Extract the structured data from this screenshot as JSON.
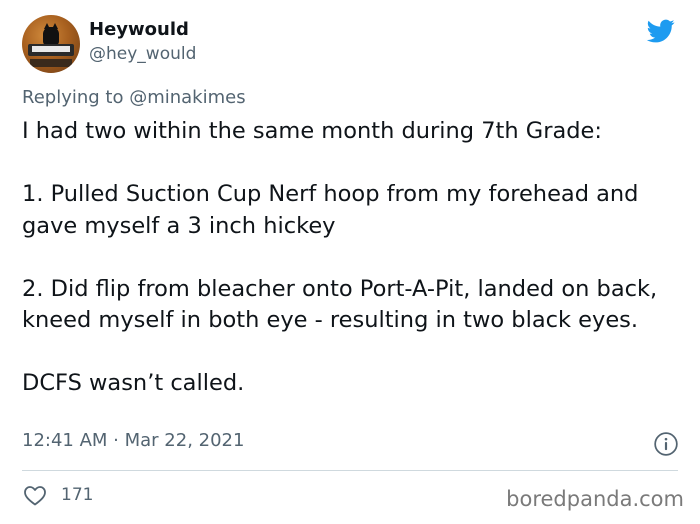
{
  "author": {
    "display_name": "Heywould",
    "handle": "@hey_would"
  },
  "reply_context": {
    "prefix": "Replying to ",
    "mention": "@minakimes"
  },
  "tweet": {
    "lines": [
      "I had two within the same month during 7th Grade:",
      "1. Pulled Suction Cup Nerf hoop from my forehead and gave myself a 3 inch hickey",
      "2. Did flip from bleacher onto Port-A-Pit, landed on back, kneed myself in both eye - resulting in two black eyes.",
      "DCFS wasn’t called."
    ],
    "timestamp": "12:41 AM · Mar 22, 2021",
    "like_count": "171"
  },
  "watermark": "boredpanda.com",
  "icons": {
    "brand": "twitter-bird-icon",
    "info": "info-icon",
    "like": "heart-icon"
  },
  "colors": {
    "twitter_blue": "#1d9bf0",
    "secondary_text": "#536471",
    "primary_text": "#0f1419"
  }
}
